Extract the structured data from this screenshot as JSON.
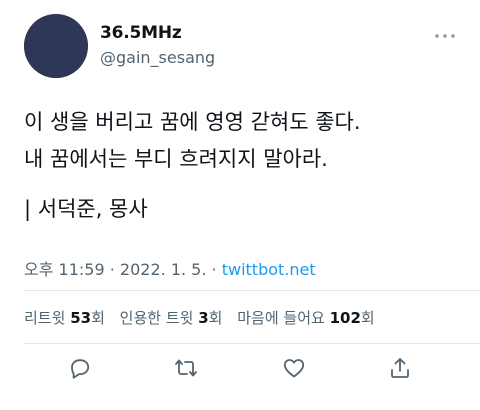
{
  "tweet": {
    "author": {
      "display_name": "36.5MHz",
      "handle": "@gain_sesang",
      "avatar_icon": "crescent-moon-icon"
    },
    "text_lines": [
      "이 생을 버리고 꿈에 영영 갇혀도 좋다.",
      "내 꿈에서는 부디 흐려지지 말아라.",
      "| 서덕준, 몽사"
    ],
    "meta": {
      "time": "오후 11:59",
      "separator": "·",
      "date": "2022. 1. 5.",
      "source": "twittbot.net"
    },
    "stats": {
      "retweets_label": "리트윗",
      "retweets_count": "53",
      "retweets_unit": "회",
      "quotes_label": "인용한 트윗",
      "quotes_count": "3",
      "quotes_unit": "회",
      "likes_label": "마음에 들어요",
      "likes_count": "102",
      "likes_unit": "회"
    },
    "actions": [
      "reply-icon",
      "retweet-icon",
      "like-icon",
      "share-icon"
    ],
    "colors": {
      "text": "#0f1419",
      "secondary": "#536471",
      "link": "#1d9bf0",
      "avatar_bg": "#2e3756"
    }
  }
}
